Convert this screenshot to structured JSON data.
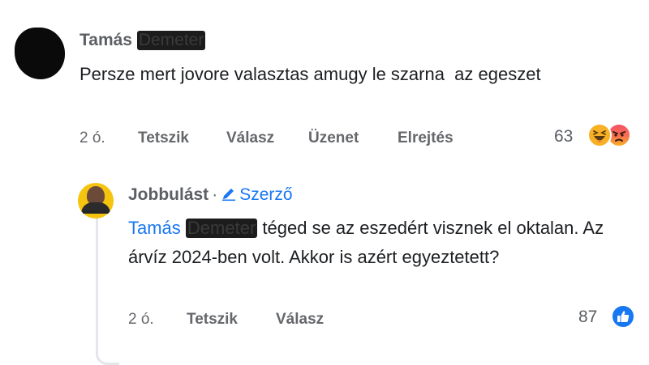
{
  "comment": {
    "author_first": "Tamás",
    "author_redacted": "Demeter",
    "text": "Persze mert jovore valasztas amugy le szarna  az egeszet",
    "time": "2 ó.",
    "actions": {
      "like": "Tetszik",
      "reply": "Válasz",
      "message": "Üzenet",
      "hide": "Elrejtés"
    },
    "reaction_count": "63",
    "reactions": [
      "haha-emoji-icon",
      "angry-emoji-icon"
    ]
  },
  "reply": {
    "author": "Jobbulást",
    "separator": "·",
    "author_badge": "Szerző",
    "avatar_label": "JOBBULÁST",
    "mention_first": "Tamás",
    "mention_redacted": "Demeter",
    "text": "téged se az eszedért visznek el oktalan. Az árvíz 2024-ben volt. Akkor is azért egyeztetett?",
    "time": "2 ó.",
    "actions": {
      "like": "Tetszik",
      "reply": "Válasz"
    },
    "reaction_count": "87",
    "reactions": [
      "like-icon"
    ]
  },
  "colors": {
    "link_blue": "#1877f2",
    "meta_gray": "#65676b",
    "thread_line": "#e4e6eb"
  }
}
